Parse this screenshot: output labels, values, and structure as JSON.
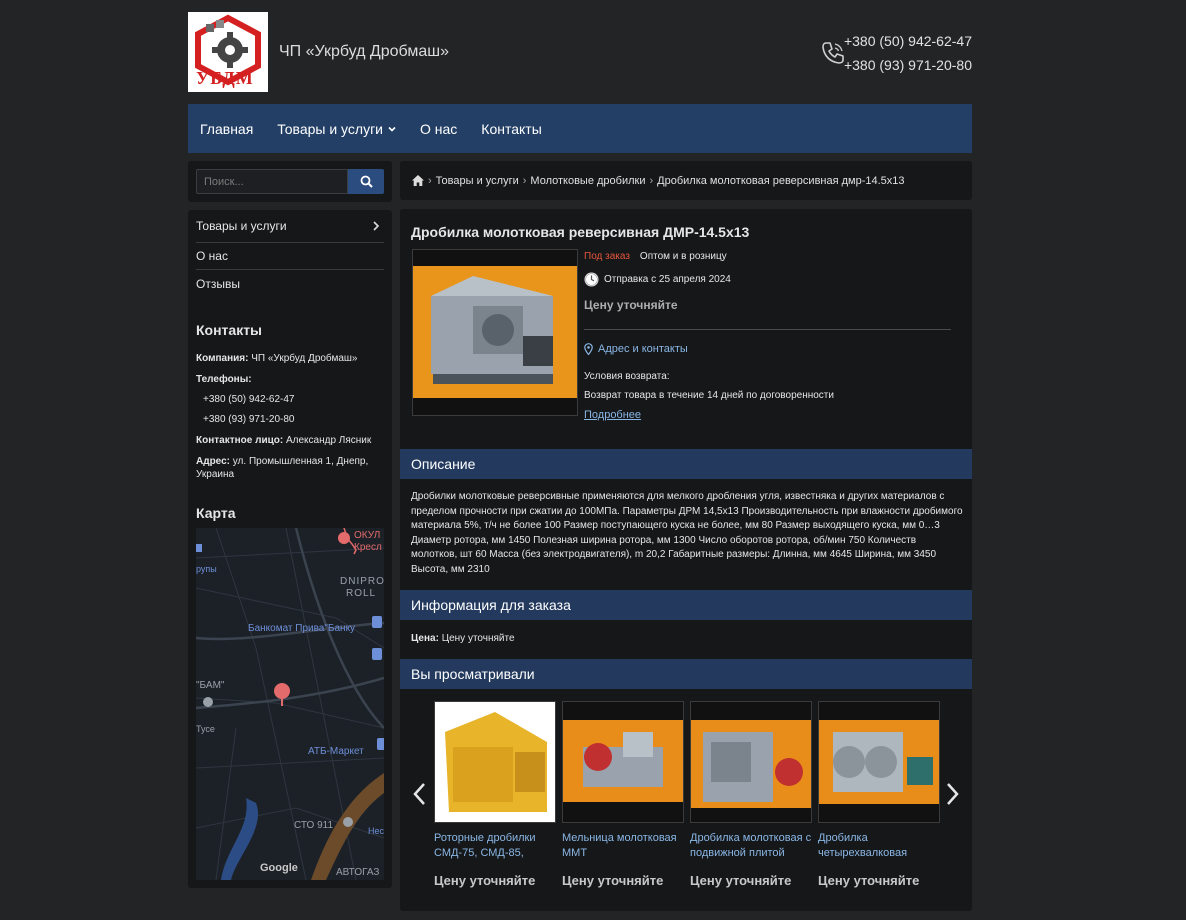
{
  "site": {
    "name": "ЧП «Укрбуд Дробмаш»",
    "logo_text": "УБДМ",
    "phones": [
      "+380 (50) 942-62-47",
      "+380 (93) 971-20-80"
    ]
  },
  "nav": {
    "items": [
      {
        "label": "Главная"
      },
      {
        "label": "Товары и услуги",
        "has_dropdown": true
      },
      {
        "label": "О нас"
      },
      {
        "label": "Контакты"
      }
    ]
  },
  "search": {
    "placeholder": "Поиск..."
  },
  "sidebar": {
    "menu": [
      {
        "label": "Товары и услуги",
        "has_arrow": true
      },
      {
        "label": "О нас"
      },
      {
        "label": "Отзывы"
      }
    ],
    "contacts_title": "Контакты",
    "company_label": "Компания:",
    "company_value": "ЧП «Укрбуд Дробмаш»",
    "phones_label": "Телефоны:",
    "phone_1": "+380 (50) 942-62-47",
    "phone_2": "+380 (93) 971-20-80",
    "person_label": "Контактное лицо:",
    "person_value": "Александр Ляcник",
    "address_label": "Адрес:",
    "address_value": "ул. Промышленная 1, Днепр, Украина",
    "map_title": "Карта",
    "map_labels": {
      "l1": "ОКУЛ",
      "l2": "Кресл",
      "l3": "DNIPRO",
      "l4": "ROLL",
      "l5": "Банкомат Прива\"Банку",
      "l6": "\"БАМ\"",
      "l7": "АТБ-Маркет",
      "l8": "СТО 911",
      "l9": "АВТОГАЗ",
      "l10": "рупы",
      "l11": "Тусе",
      "l12": "Нес",
      "l13": "Google"
    }
  },
  "breadcrumb": [
    "Товары и услуги",
    "Молотковые дробилки",
    "Дробилка молотковая реверсивная дмр-14.5х13"
  ],
  "product": {
    "title": "Дробилка молотковая реверсивная ДМР-14.5х13",
    "status": "Под заказ",
    "sale_type": "Оптом и в розницу",
    "shipping": "Отправка с 25 апреля 2024",
    "price_note": "Цену уточняйте",
    "address_link": "Адрес и контакты",
    "return_title": "Условия возврата:",
    "return_text": "Возврат товара в течение 14 дней по договоренности",
    "more_link": "Подробнее"
  },
  "sections": {
    "description_title": "Описание",
    "description_text": "Дробилки молотковые реверсивные применяются для мелкого дробления угля, известняка и других материалов с пределом прочности при сжатии до 100МПа. Параметры ДРМ 14,5х13 Производительность при влажности дробимого материала 5%, т/ч не более 100 Размер поступающего куска не более, мм 80 Размер выходящего куска, мм 0…3 Диаметр ротора, мм 1450 Полезная ширина ротора, мм 1300 Число оборотов ротора, об/мин 750 Количеств молотков, шт 60 Масса (без электродвигателя), m 20,2 Габаритные размеры: Длинна, мм 4645 Ширина, мм 3450 Высота, мм 2310",
    "order_title": "Информация для заказа",
    "order_label": "Цена:",
    "order_value": "Цену уточняйте",
    "viewed_title": "Вы просматривали"
  },
  "viewed": [
    {
      "name": "Роторные дробилки СМД-75, СМД-85,",
      "price": "Цену уточняйте"
    },
    {
      "name": "Мельница молотковая ММТ",
      "price": "Цену уточняйте"
    },
    {
      "name": "Дробилка молотковая с подвижной плитой",
      "price": "Цену уточняйте"
    },
    {
      "name": "Дробилка четырехвалковая",
      "price": "Цену уточняйте"
    }
  ],
  "colors": {
    "page_bg": "#222426",
    "panel_bg": "#161719",
    "nav_bg": "#233f66",
    "section_head_bg": "#233a5e",
    "link": "#8ab7e6",
    "status_order": "#e5563a"
  }
}
